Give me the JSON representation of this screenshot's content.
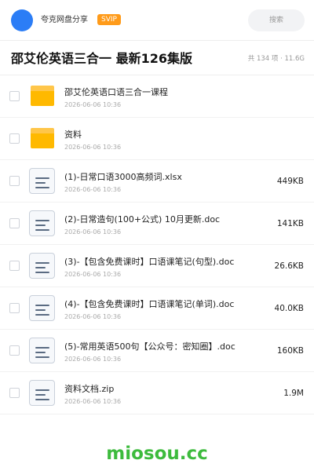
{
  "header": {
    "sharer_name": "夸克网盘分享",
    "vip_badge": "SVIP",
    "search_placeholder": "搜索",
    "colors": {
      "avatar": "#2b7df6",
      "vip": "#ff9b1a"
    }
  },
  "folder": {
    "title": "邵艾伦英语三合一 最新126集版",
    "summary": "共 134 项 · 11.6G"
  },
  "files": [
    {
      "icon": "folder-icon",
      "name": "邵艾伦英语口语三合一课程",
      "date": "2026-06-06 10:36",
      "size": ""
    },
    {
      "icon": "folder-icon",
      "name": "资料",
      "date": "2026-06-06 10:36",
      "size": ""
    },
    {
      "icon": "document-icon",
      "name": "(1)-日常口语3000高频词.xlsx",
      "date": "2026-06-06 10:36",
      "size": "449KB"
    },
    {
      "icon": "document-icon",
      "name": "(2)-日常造句(100+公式) 10月更新.doc",
      "date": "2026-06-06 10:36",
      "size": "141KB"
    },
    {
      "icon": "document-icon",
      "name": "(3)-【包含免费课时】口语课笔记(句型).doc",
      "date": "2026-06-06 10:36",
      "size": "26.6KB"
    },
    {
      "icon": "document-icon",
      "name": "(4)-【包含免费课时】口语课笔记(单词).doc",
      "date": "2026-06-06 10:36",
      "size": "40.0KB"
    },
    {
      "icon": "document-icon",
      "name": "(5)-常用英语500句【公众号：密知圈】.doc",
      "date": "2026-06-06 10:36",
      "size": "160KB"
    },
    {
      "icon": "document-icon",
      "name": "资料文档.zip",
      "date": "2026-06-06 10:36",
      "size": "1.9M"
    }
  ],
  "watermark": {
    "text": "miosou.cc",
    "color": "#3dbb3d"
  }
}
